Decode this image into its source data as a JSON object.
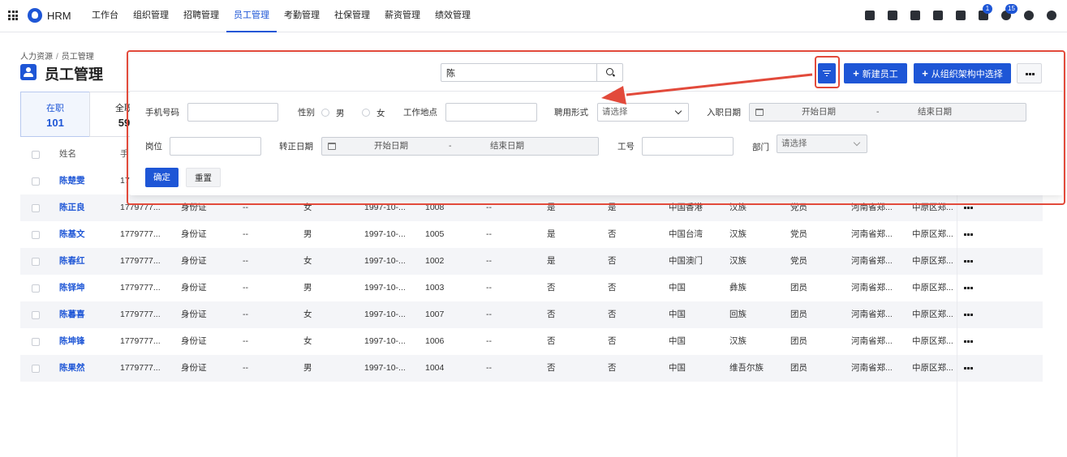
{
  "app": {
    "brand": "HRM",
    "brand_color": "#1e56d6",
    "annotation_color": "#e24a3b"
  },
  "nav": {
    "items": [
      {
        "label": "工作台",
        "active": false
      },
      {
        "label": "组织管理",
        "active": false
      },
      {
        "label": "招聘管理",
        "active": false
      },
      {
        "label": "员工管理",
        "active": true
      },
      {
        "label": "考勤管理",
        "active": false
      },
      {
        "label": "社保管理",
        "active": false
      },
      {
        "label": "薪资管理",
        "active": false
      },
      {
        "label": "绩效管理",
        "active": false
      }
    ],
    "icons": [
      {
        "name": "calendar-check-icon"
      },
      {
        "name": "user-icon"
      },
      {
        "name": "document-icon"
      },
      {
        "name": "phone-icon"
      },
      {
        "name": "calendar-icon"
      },
      {
        "name": "flag-icon",
        "badge": "1"
      },
      {
        "name": "bell-icon",
        "badge": "15"
      },
      {
        "name": "help-icon"
      },
      {
        "name": "settings-icon"
      }
    ]
  },
  "breadcrumb": {
    "root": "人力资源",
    "separator": "/",
    "current": "员工管理"
  },
  "page": {
    "title": "员工管理"
  },
  "stats": [
    {
      "label": "在职",
      "count": "101",
      "active": true
    },
    {
      "label": "全职",
      "count": "59",
      "active": false
    }
  ],
  "table": {
    "headers": [
      "姓名",
      "手"
    ],
    "rows": [
      {
        "name": "陈楚雯",
        "phone": "17",
        "id_type": "",
        "c4": "",
        "gender": "",
        "birth": "",
        "emp_no": "",
        "c8": "",
        "c9": "",
        "c10": "",
        "country": "",
        "ethnicity": "",
        "politics": "",
        "province": "",
        "district": ""
      },
      {
        "name": "陈正良",
        "phone": "1779777...",
        "id_type": "身份证",
        "c4": "--",
        "gender": "女",
        "birth": "1997-10-...",
        "emp_no": "1008",
        "c8": "--",
        "c9": "是",
        "c10": "是",
        "country": "中国香港",
        "ethnicity": "汉族",
        "politics": "党员",
        "province": "河南省郑...",
        "district": "中原区郑..."
      },
      {
        "name": "陈基文",
        "phone": "1779777...",
        "id_type": "身份证",
        "c4": "--",
        "gender": "男",
        "birth": "1997-10-...",
        "emp_no": "1005",
        "c8": "--",
        "c9": "是",
        "c10": "否",
        "country": "中国台湾",
        "ethnicity": "汉族",
        "politics": "党员",
        "province": "河南省郑...",
        "district": "中原区郑..."
      },
      {
        "name": "陈春红",
        "phone": "1779777...",
        "id_type": "身份证",
        "c4": "--",
        "gender": "女",
        "birth": "1997-10-...",
        "emp_no": "1002",
        "c8": "--",
        "c9": "是",
        "c10": "否",
        "country": "中国澳门",
        "ethnicity": "汉族",
        "politics": "党员",
        "province": "河南省郑...",
        "district": "中原区郑..."
      },
      {
        "name": "陈铎坤",
        "phone": "1779777...",
        "id_type": "身份证",
        "c4": "--",
        "gender": "男",
        "birth": "1997-10-...",
        "emp_no": "1003",
        "c8": "--",
        "c9": "否",
        "c10": "否",
        "country": "中国",
        "ethnicity": "彝族",
        "politics": "团员",
        "province": "河南省郑...",
        "district": "中原区郑..."
      },
      {
        "name": "陈暮喜",
        "phone": "1779777...",
        "id_type": "身份证",
        "c4": "--",
        "gender": "女",
        "birth": "1997-10-...",
        "emp_no": "1007",
        "c8": "--",
        "c9": "否",
        "c10": "否",
        "country": "中国",
        "ethnicity": "回族",
        "politics": "团员",
        "province": "河南省郑...",
        "district": "中原区郑..."
      },
      {
        "name": "陈坤锋",
        "phone": "1779777...",
        "id_type": "身份证",
        "c4": "--",
        "gender": "女",
        "birth": "1997-10-...",
        "emp_no": "1006",
        "c8": "--",
        "c9": "否",
        "c10": "否",
        "country": "中国",
        "ethnicity": "汉族",
        "politics": "团员",
        "province": "河南省郑...",
        "district": "中原区郑..."
      },
      {
        "name": "陈果然",
        "phone": "1779777...",
        "id_type": "身份证",
        "c4": "--",
        "gender": "男",
        "birth": "1997-10-...",
        "emp_no": "1004",
        "c8": "--",
        "c9": "否",
        "c10": "否",
        "country": "中国",
        "ethnicity": "维吾尔族",
        "politics": "团员",
        "province": "河南省郑...",
        "district": "中原区郑..."
      }
    ]
  },
  "filter": {
    "search_value": "陈",
    "new_button": "新建员工",
    "org_button": "从组织架构中选择",
    "fields": {
      "phone": "手机号码",
      "gender": "性别",
      "male": "男",
      "female": "女",
      "workplace": "工作地点",
      "employment": "聘用形式",
      "employment_placeholder": "请选择",
      "hire_date": "入职日期",
      "date_start": "开始日期",
      "date_dash": "-",
      "date_end": "结束日期",
      "position": "岗位",
      "regular_date": "转正日期",
      "emp_no": "工号",
      "department": "部门",
      "department_placeholder": "请选择"
    },
    "confirm": "确定",
    "reset": "重置"
  }
}
